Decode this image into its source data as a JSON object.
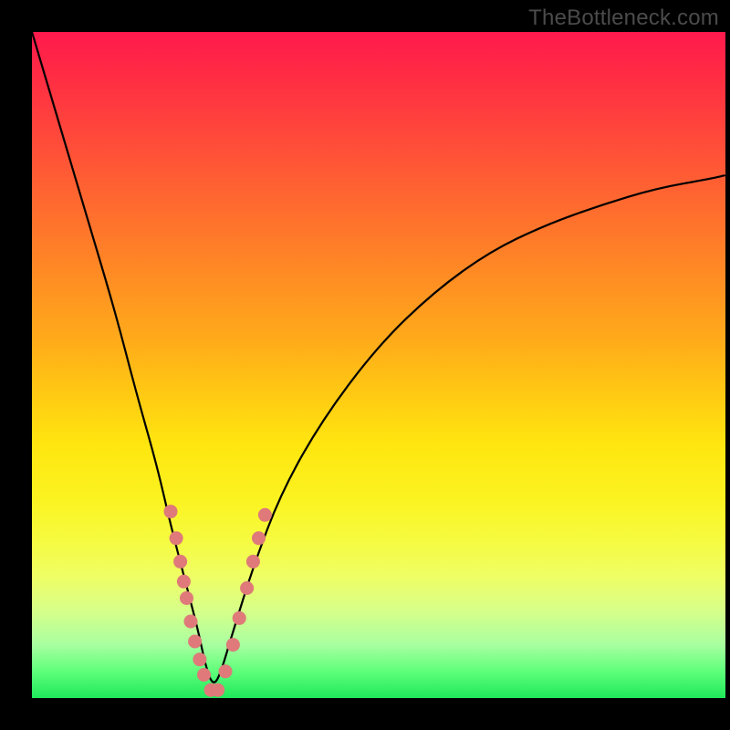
{
  "watermark": "TheBottleneck.com",
  "colors": {
    "frame": "#000000",
    "dot": "#e07a7a",
    "curve": "#000000",
    "gradient_stops": [
      "#ff1a4d",
      "#ff6a2f",
      "#ffe60f",
      "#1fe85a"
    ]
  },
  "chart_data": {
    "type": "line",
    "title": "",
    "xlabel": "",
    "ylabel": "",
    "xlim": [
      0,
      100
    ],
    "ylim": [
      0,
      100
    ],
    "grid": false,
    "legend": false,
    "annotations": [
      "TheBottleneck.com"
    ],
    "series": [
      {
        "name": "bottleneck-curve",
        "x": [
          0,
          4,
          8,
          12,
          15,
          18,
          20,
          22,
          24,
          25,
          26,
          27,
          29,
          32,
          36,
          42,
          50,
          58,
          66,
          74,
          82,
          90,
          98,
          100
        ],
        "y": [
          100,
          86,
          72,
          58,
          46,
          35,
          26,
          18,
          10,
          5,
          2,
          3,
          10,
          20,
          31,
          42,
          53,
          61,
          67,
          71,
          74,
          76.5,
          78,
          78.5
        ]
      }
    ],
    "scatter_points": {
      "name": "marker-dots",
      "x": [
        20.0,
        20.8,
        21.4,
        21.9,
        22.3,
        22.9,
        23.5,
        24.2,
        24.8,
        25.8,
        26.8,
        27.9,
        29.0,
        29.9,
        31.0,
        31.9,
        32.7,
        33.6
      ],
      "y": [
        28.0,
        24.0,
        20.5,
        17.5,
        15.0,
        11.5,
        8.5,
        5.8,
        3.5,
        1.2,
        1.2,
        4.0,
        8.0,
        12.0,
        16.5,
        20.5,
        24.0,
        27.5
      ]
    }
  }
}
